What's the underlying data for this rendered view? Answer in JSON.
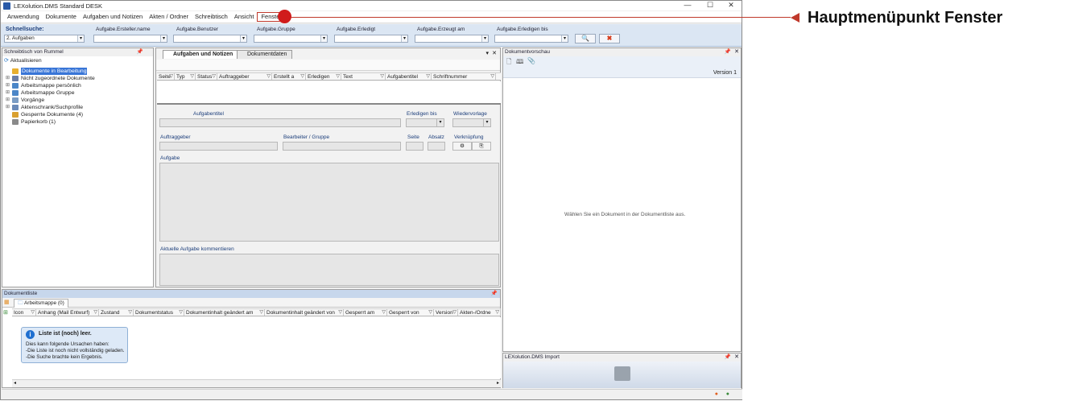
{
  "window": {
    "title": "LEXolution.DMS Standard DESK",
    "controls": {
      "minimize": "—",
      "maximize": "☐",
      "close": "✕"
    }
  },
  "menu": [
    "Anwendung",
    "Dokumente",
    "Aufgaben und Notizen",
    "Akten / Ordner",
    "Schreibtisch",
    "Ansicht",
    "Fenster"
  ],
  "quicksearch": {
    "label": "Schnellsuche:",
    "value": "2. Aufgaben",
    "fields": [
      "Aufgabe.Ersteller.name",
      "Aufgabe.Benutzer",
      "Aufgabe.Gruppe",
      "Aufgabe.Erledigt",
      "Aufgabe.Erzeugt am",
      "Aufgabe.Erledigen bis"
    ],
    "search_icon": "search-icon",
    "clear_icon": "clear-icon",
    "accent": "#d63a1a"
  },
  "desk": {
    "title": "Schreibtisch von Rummel",
    "refresh": "Aktualisieren",
    "tree": [
      {
        "label": "Dokumente in Bearbeitung",
        "selected": true,
        "color": "#e8b030"
      },
      {
        "label": "Nicht zugeordnete Dokumente",
        "expand": "⊞",
        "color": "#6b7fa8"
      },
      {
        "label": "Arbeitsmappe persönlich",
        "expand": "⊞",
        "color": "#4b86c8"
      },
      {
        "label": "Arbeitsmappe Gruppe",
        "expand": "⊞",
        "color": "#4b86c8"
      },
      {
        "label": "Vorgänge",
        "expand": "⊞",
        "color": "#7a9cc4"
      },
      {
        "label": "Aktenschrank/Suchprofile",
        "expand": "⊞",
        "color": "#6a8ab8"
      },
      {
        "label": "Gesperrte Dokumente (4)",
        "color": "#d9a030"
      },
      {
        "label": "Papierkorb (1)",
        "color": "#8a8a8a"
      }
    ]
  },
  "tasks": {
    "tabs": [
      "Aufgaben und Notizen",
      "Dokumentdaten"
    ],
    "columns": [
      "Seite",
      "Typ",
      "Status",
      "Auftraggeber",
      "Erstellt a",
      "Erledigen",
      "Text",
      "Aufgabentitel",
      "Schriftnummer"
    ],
    "fields": {
      "title": "Aufgabentitel",
      "due": "Erledigen bis",
      "resubmit": "Wiedervorlage",
      "client": "Auftraggeber",
      "editor": "Bearbeiter / Gruppe",
      "page": "Seite",
      "paragraph": "Absatz",
      "link": "Verknüpfung",
      "task": "Aufgabe",
      "comment": "Aktuelle Aufgabe kommentieren"
    }
  },
  "preview": {
    "title": "Dokumentvorschau",
    "version": "Version 1",
    "empty_text": "Wählen Sie ein Dokument in der Dokumentliste aus."
  },
  "doclist": {
    "title": "Dokumentliste",
    "tab": "Arbeitsmappe (0)",
    "columns": [
      "Icon",
      "Anhang (Mail Entwurf)",
      "Zustand",
      "Dokumentstatus",
      "Dokumentinhalt geändert am",
      "Dokumentinhalt geändert von",
      "Gesperrt am",
      "Gesperrt von",
      "Version",
      "Akten-/Ordne"
    ],
    "empty": {
      "title": "Liste ist (noch) leer.",
      "lines": [
        "Dies kann folgende Ursachen haben:",
        "-Die Liste ist noch nicht vollständig geladen.",
        "-Die Suche brachte kein Ergebnis."
      ]
    }
  },
  "import": {
    "title": "LEXolution.DMS Import"
  },
  "annotation": {
    "text": "Hauptmenüpunkt Fenster",
    "color": "#c0392b"
  }
}
